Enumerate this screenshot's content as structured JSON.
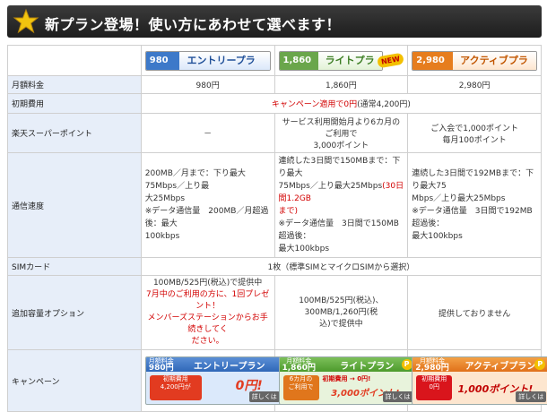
{
  "banner": {
    "title": "新プラン登場！使い方にあわせて選べます！"
  },
  "plans": [
    {
      "price": "980円",
      "name": "エントリープラン"
    },
    {
      "price": "1,860円",
      "name": "ライトプラン",
      "badge": "NEW"
    },
    {
      "price": "2,980円",
      "name": "アクティブプラン"
    }
  ],
  "rows": {
    "monthly": {
      "label": "月額料金",
      "entry": "980円",
      "lite": "1,860円",
      "active": "2,980円"
    },
    "initial": {
      "label": "初期費用",
      "campaign": "キャンペーン適用で",
      "zero": "0円",
      "normal": "(通常4,200円)"
    },
    "points": {
      "label": "楽天スーパーポイント",
      "entry": "－",
      "lite": [
        "サービス利用開始月より6カ月のご利用で",
        "3,000ポイント"
      ],
      "active": [
        "ご入会で1,000ポイント",
        "毎月100ポイント"
      ]
    },
    "speed": {
      "label": "通信速度",
      "entry": [
        "200MB／月まで：下り最大75Mbps／上り最",
        "大25Mbps",
        "※データ通信量　200MB／月超過後：最大",
        "100kbps"
      ],
      "lite_a": "連続した3日間で150MBまで：下り最大",
      "lite_b": "75Mbps／上り最大25Mbps",
      "lite_red": "(30日間1.2GB",
      "lite_red2": "まで)",
      "lite_c": "※データ通信量　3日間で150MB超過後：",
      "lite_d": "最大100kbps",
      "active": [
        "連続した3日間で192MBまで：下り最大75",
        "Mbps／上り最大25Mbps",
        "※データ通信量　3日間で192MB超過後：",
        "最大100kbps"
      ]
    },
    "sim": {
      "label": "SIMカード",
      "value": "1枚（標準SIMとマイクロSIMから選択）"
    },
    "option": {
      "label": "追加容量オプション",
      "entry_a": "100MB/525円(税込)で提供中",
      "entry_red": [
        "7月中のご利用の方に、1回プレゼント！",
        "メンバーズステーションからお手続きしてく",
        "ださい。"
      ],
      "lite": [
        "100MB/525円(税込)、300MB/1,260円(税",
        "込)で提供中"
      ],
      "active": "提供しておりません"
    },
    "campaign": {
      "label": "キャンペーン"
    }
  },
  "campaign_banners": [
    {
      "mini": "月額料金",
      "price": "980円",
      "name": "エントリープラン",
      "left": [
        "初期費用",
        "4,200円が"
      ],
      "amount": "0円!",
      "detail": "詳しくは"
    },
    {
      "mini": "月額料金",
      "price": "1,860円",
      "name": "ライトプラン",
      "left": [
        "6カ月の",
        "ご利用で"
      ],
      "top_right": "初期費用 → 0円!",
      "amount": "3,000ポイント!",
      "detail": "詳しくは",
      "coin": "P"
    },
    {
      "mini": "月額料金",
      "price": "2,980円",
      "name": "アクティブプラン",
      "left": [
        "初期費用",
        "0円"
      ],
      "amount": "1,000ポイント!",
      "detail": "詳しくは",
      "coin": "P"
    }
  ],
  "colors": {
    "banner_bg": "#2b2b2b",
    "label_bg": "#e7eef9",
    "accent_red": "#d20000",
    "entry": "#3d79c9",
    "lite": "#6aa64b",
    "active": "#e67d1e"
  }
}
